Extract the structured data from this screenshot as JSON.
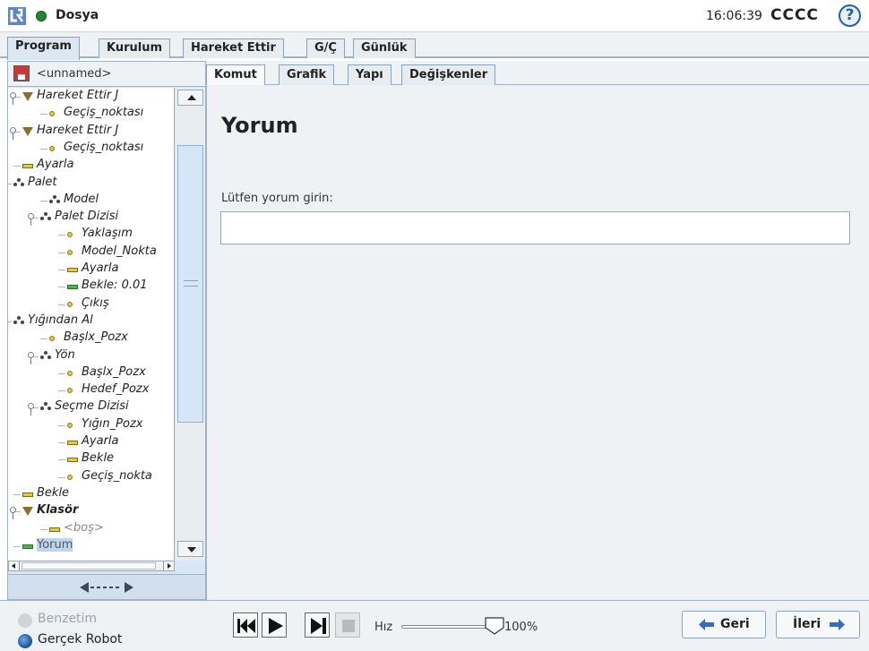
{
  "topbar": {
    "file_menu": "Dosya",
    "time": "16:06:39",
    "robot_name": "CCCC",
    "help": "?"
  },
  "main_tabs": [
    "Program",
    "Kurulum",
    "Hareket Ettir",
    "G/Ç",
    "Günlük"
  ],
  "left_panel": {
    "program_name": "<unnamed>",
    "tree": [
      {
        "label": "Hareket Ettir J",
        "icon": "movej-icon"
      },
      {
        "label": "Geçiş_noktası",
        "icon": "waypoint-icon"
      },
      {
        "label": "Hareket Ettir J",
        "icon": "movej-icon"
      },
      {
        "label": "Geçiş_noktası",
        "icon": "waypoint-icon"
      },
      {
        "label": "Ayarla",
        "icon": "set-icon"
      },
      {
        "label": "Palet",
        "icon": "pallet-icon"
      },
      {
        "label": "Model",
        "icon": "pattern-icon"
      },
      {
        "label": "Palet Dizisi",
        "icon": "pattern-icon"
      },
      {
        "label": "Yaklaşım",
        "icon": "waypoint-icon"
      },
      {
        "label": "Model_Nokta",
        "icon": "waypoint-icon"
      },
      {
        "label": "Ayarla",
        "icon": "set-icon"
      },
      {
        "label": "Bekle: 0.01",
        "icon": "wait-icon"
      },
      {
        "label": "Çıkış",
        "icon": "waypoint-icon"
      },
      {
        "label": "Yığından Al",
        "icon": "destack-icon"
      },
      {
        "label": "Başlx_Pozx",
        "icon": "waypoint-icon"
      },
      {
        "label": "Yön",
        "icon": "direction-icon"
      },
      {
        "label": "Başlx_Pozx",
        "icon": "waypoint-icon"
      },
      {
        "label": "Hedef_Pozx",
        "icon": "waypoint-icon"
      },
      {
        "label": "Seçme Dizisi",
        "icon": "pattern-icon"
      },
      {
        "label": "Yığın_Pozx",
        "icon": "waypoint-icon"
      },
      {
        "label": "Ayarla",
        "icon": "set-icon"
      },
      {
        "label": "Bekle",
        "icon": "wait-icon"
      },
      {
        "label": "Geçiş_nokta",
        "icon": "waypoint-icon"
      },
      {
        "label": "Bekle",
        "icon": "wait-icon"
      },
      {
        "label": "Klasör",
        "icon": "folder-icon"
      },
      {
        "label": "<boş>",
        "icon": "empty-icon"
      },
      {
        "label": "Yorum",
        "icon": "comment-icon"
      }
    ]
  },
  "sub_tabs": [
    "Komut",
    "Grafik",
    "Yapı",
    "Değişkenler"
  ],
  "panel": {
    "title": "Yorum",
    "prompt": "Lütfen yorum girin:",
    "input_value": ""
  },
  "bottom": {
    "simulation": "Benzetim",
    "real_robot": "Gerçek Robot",
    "speed_label": "Hız",
    "speed_value": "100%",
    "speed_fraction": 1.0,
    "back": "Geri",
    "next": "İleri"
  }
}
